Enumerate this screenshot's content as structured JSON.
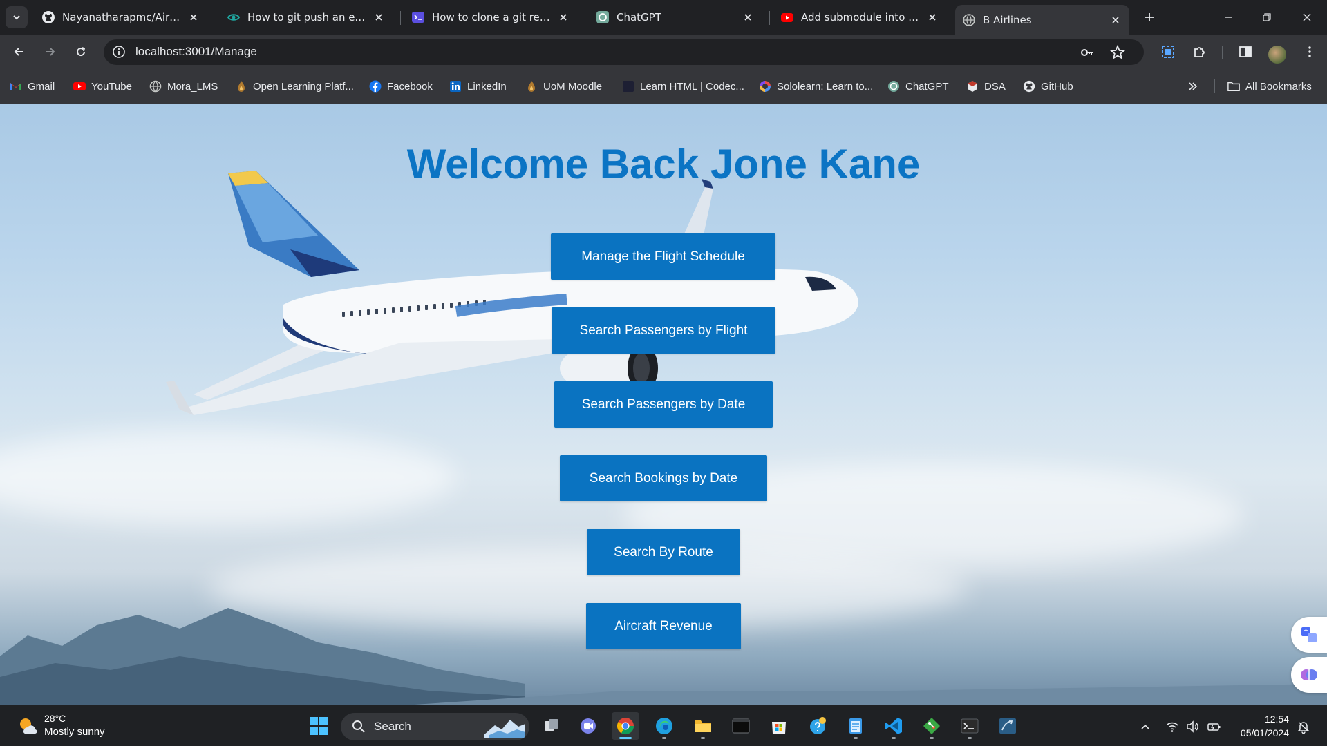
{
  "browser": {
    "tabs": [
      {
        "title": "Nayanatharapmc/Airline_R",
        "icon": "github-icon"
      },
      {
        "title": "How to git push an existing",
        "icon": "eye-icon"
      },
      {
        "title": "How to clone a git reposito",
        "icon": "terminal-icon"
      },
      {
        "title": "ChatGPT",
        "icon": "chatgpt-icon"
      },
      {
        "title": "Add submodule into centr",
        "icon": "youtube-icon"
      },
      {
        "title": "B Airlines",
        "icon": "globe-icon"
      }
    ],
    "url": "localhost:3001/Manage",
    "bookmarks": [
      {
        "label": "Gmail",
        "icon": "gmail-icon"
      },
      {
        "label": "YouTube",
        "icon": "youtube-icon"
      },
      {
        "label": "Mora_LMS",
        "icon": "globe-icon"
      },
      {
        "label": "Open Learning Platf...",
        "icon": "flame-icon"
      },
      {
        "label": "Facebook",
        "icon": "facebook-icon"
      },
      {
        "label": "LinkedIn",
        "icon": "linkedin-icon"
      },
      {
        "label": "UoM Moodle",
        "icon": "flame-icon"
      },
      {
        "label": "Learn HTML | Codec...",
        "icon": "codecademy-icon"
      },
      {
        "label": "Sololearn: Learn to...",
        "icon": "sololearn-icon"
      },
      {
        "label": "ChatGPT",
        "icon": "chatgpt-icon"
      },
      {
        "label": "DSA",
        "icon": "dsa-icon"
      },
      {
        "label": "GitHub",
        "icon": "github-icon"
      }
    ],
    "all_bookmarks": "All Bookmarks"
  },
  "page": {
    "welcome": "Welcome Back Jone Kane",
    "buttons": [
      "Manage the Flight Schedule",
      "Search Passengers by Flight",
      "Search Passengers by Date",
      "Search Bookings by Date",
      "Search By Route",
      "Aircraft Revenue"
    ]
  },
  "taskbar": {
    "weather_temp": "28°C",
    "weather_condition": "Mostly sunny",
    "search_label": "Search",
    "time": "12:54",
    "date": "05/01/2024"
  },
  "colors": {
    "accent_blue": "#0a73c1",
    "heading_blue": "#0b74c4",
    "browser_dark": "#202124"
  }
}
